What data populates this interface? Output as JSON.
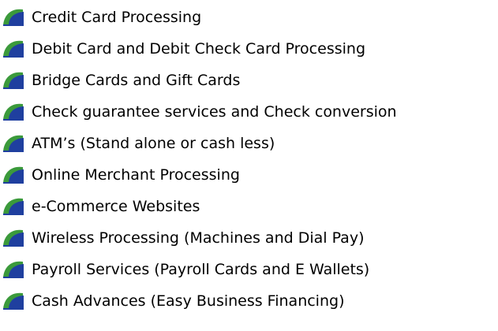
{
  "services": {
    "items": [
      {
        "label": "Credit Card Processing",
        "icon": "green-blue-bullet-icon"
      },
      {
        "label": "Debit Card and Debit Check Card Processing",
        "icon": "green-blue-bullet-icon"
      },
      {
        "label": "Bridge Cards and Gift Cards",
        "icon": "green-blue-bullet-icon"
      },
      {
        "label": "Check guarantee services and Check conversion",
        "icon": "green-blue-bullet-icon"
      },
      {
        "label": "ATM’s  (Stand alone or cash less)",
        "icon": "green-blue-bullet-icon"
      },
      {
        "label": "Online Merchant Processing",
        "icon": "green-blue-bullet-icon"
      },
      {
        "label": "e-Commerce Websites",
        "icon": "green-blue-bullet-icon"
      },
      {
        "label": "Wireless Processing (Machines and Dial Pay)",
        "icon": "green-blue-bullet-icon"
      },
      {
        "label": "Payroll Services (Payroll Cards and E Wallets)",
        "icon": "green-blue-bullet-icon"
      },
      {
        "label": "Cash Advances (Easy Business Financing)",
        "icon": "green-blue-bullet-icon"
      }
    ]
  },
  "colors": {
    "bullet_green": "#3b9a3b",
    "bullet_blue": "#1f3f9f",
    "text": "#000000"
  }
}
